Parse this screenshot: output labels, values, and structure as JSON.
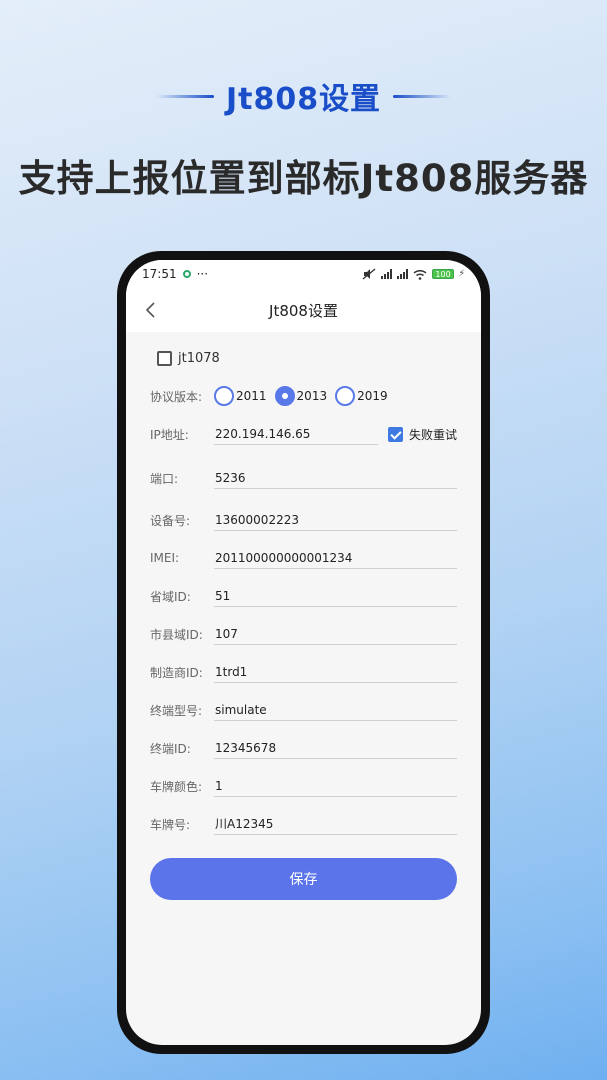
{
  "banner": {
    "title": "Jt808设置"
  },
  "headline": "支持上报位置到部标Jt808服务器",
  "status_bar": {
    "time": "17:51",
    "battery": "100"
  },
  "nav": {
    "title": "Jt808设置"
  },
  "jt1078": {
    "label": "jt1078",
    "checked": false
  },
  "protocol": {
    "label": "协议版本:",
    "options": [
      "2011",
      "2013",
      "2019"
    ],
    "selected": "2013"
  },
  "ip": {
    "label": "IP地址:",
    "value": "220.194.146.65"
  },
  "retry": {
    "label": "失败重试",
    "checked": true
  },
  "fields": [
    {
      "label": "端口:",
      "value": "5236"
    },
    {
      "label": "设备号:",
      "value": "13600002223"
    },
    {
      "label": "IMEI:",
      "value": "201100000000001234"
    },
    {
      "label": "省域ID:",
      "value": "51"
    },
    {
      "label": "市县域ID:",
      "value": "107"
    },
    {
      "label": "制造商ID:",
      "value": "1trd1"
    },
    {
      "label": "终端型号:",
      "value": "simulate"
    },
    {
      "label": "终端ID:",
      "value": "12345678"
    },
    {
      "label": "车牌颜色:",
      "value": "1"
    },
    {
      "label": "车牌号:",
      "value": "川A12345"
    }
  ],
  "save": {
    "label": "保存"
  },
  "colors": {
    "accent": "#5c74ea",
    "brand": "#1a4dc8",
    "check": "#3f7ae3"
  }
}
